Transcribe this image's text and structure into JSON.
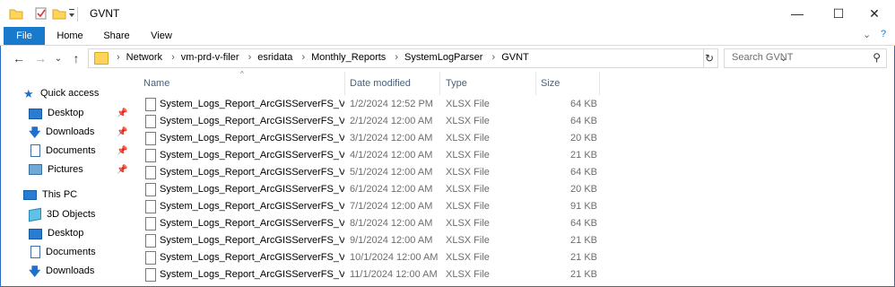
{
  "window": {
    "title": "GVNT",
    "minimize_glyph": "—",
    "maximize_glyph": "☐",
    "close_glyph": "✕",
    "accent_color": "#1979ca"
  },
  "quick_access_toolbar": {
    "icons": [
      "folder-icon",
      "properties-check-icon",
      "new-folder-icon",
      "customize-dropdown-icon"
    ]
  },
  "ribbon": {
    "tabs": [
      "File",
      "Home",
      "Share",
      "View"
    ],
    "collapse_glyph": "⌄",
    "help_glyph": "?"
  },
  "navigation": {
    "back_glyph": "←",
    "forward_glyph": "→",
    "recent_glyph": "⌄",
    "up_glyph": "↑",
    "refresh_glyph": "↻",
    "address_dropdown_glyph": "⌄",
    "breadcrumb": [
      "Network",
      "vm-prd-v-filer",
      "esridata",
      "Monthly_Reports",
      "SystemLogParser",
      "GVNT"
    ],
    "breadcrumb_separator": "›",
    "search_placeholder": "Search GVNT",
    "search_glyph": "⚲"
  },
  "sidebar": {
    "pin_glyph": "📌",
    "items": [
      {
        "label": "Quick access",
        "icon": "star-icon"
      },
      {
        "label": "Desktop",
        "icon": "desktop-icon",
        "pinned": true
      },
      {
        "label": "Downloads",
        "icon": "download-icon",
        "pinned": true
      },
      {
        "label": "Documents",
        "icon": "documents-icon",
        "pinned": true
      },
      {
        "label": "Pictures",
        "icon": "pictures-icon",
        "pinned": true
      },
      {
        "label": "This PC",
        "icon": "computer-icon"
      },
      {
        "label": "3D Objects",
        "icon": "3d-objects-icon"
      },
      {
        "label": "Desktop",
        "icon": "desktop-icon"
      },
      {
        "label": "Documents",
        "icon": "documents-icon"
      },
      {
        "label": "Downloads",
        "icon": "download-icon"
      }
    ]
  },
  "file_list": {
    "sort_indicator": "^",
    "columns": [
      "Name",
      "Date modified",
      "Type",
      "Size"
    ],
    "rows": [
      {
        "name": "System_Logs_Report_ArcGISServerFS_VM...",
        "date": "1/2/2024 12:52 PM",
        "type": "XLSX File",
        "size": "64 KB"
      },
      {
        "name": "System_Logs_Report_ArcGISServerFS_VM...",
        "date": "2/1/2024 12:00 AM",
        "type": "XLSX File",
        "size": "64 KB"
      },
      {
        "name": "System_Logs_Report_ArcGISServerFS_VM...",
        "date": "3/1/2024 12:00 AM",
        "type": "XLSX File",
        "size": "20 KB"
      },
      {
        "name": "System_Logs_Report_ArcGISServerFS_VM...",
        "date": "4/1/2024 12:00 AM",
        "type": "XLSX File",
        "size": "21 KB"
      },
      {
        "name": "System_Logs_Report_ArcGISServerFS_VM...",
        "date": "5/1/2024 12:00 AM",
        "type": "XLSX File",
        "size": "64 KB"
      },
      {
        "name": "System_Logs_Report_ArcGISServerFS_VM...",
        "date": "6/1/2024 12:00 AM",
        "type": "XLSX File",
        "size": "20 KB"
      },
      {
        "name": "System_Logs_Report_ArcGISServerFS_VM...",
        "date": "7/1/2024 12:00 AM",
        "type": "XLSX File",
        "size": "91 KB"
      },
      {
        "name": "System_Logs_Report_ArcGISServerFS_VM...",
        "date": "8/1/2024 12:00 AM",
        "type": "XLSX File",
        "size": "64 KB"
      },
      {
        "name": "System_Logs_Report_ArcGISServerFS_VM...",
        "date": "9/1/2024 12:00 AM",
        "type": "XLSX File",
        "size": "21 KB"
      },
      {
        "name": "System_Logs_Report_ArcGISServerFS_VM...",
        "date": "10/1/2024 12:00 AM",
        "type": "XLSX File",
        "size": "21 KB"
      },
      {
        "name": "System_Logs_Report_ArcGISServerFS_VM...",
        "date": "11/1/2024 12:00 AM",
        "type": "XLSX File",
        "size": "21 KB"
      }
    ]
  }
}
